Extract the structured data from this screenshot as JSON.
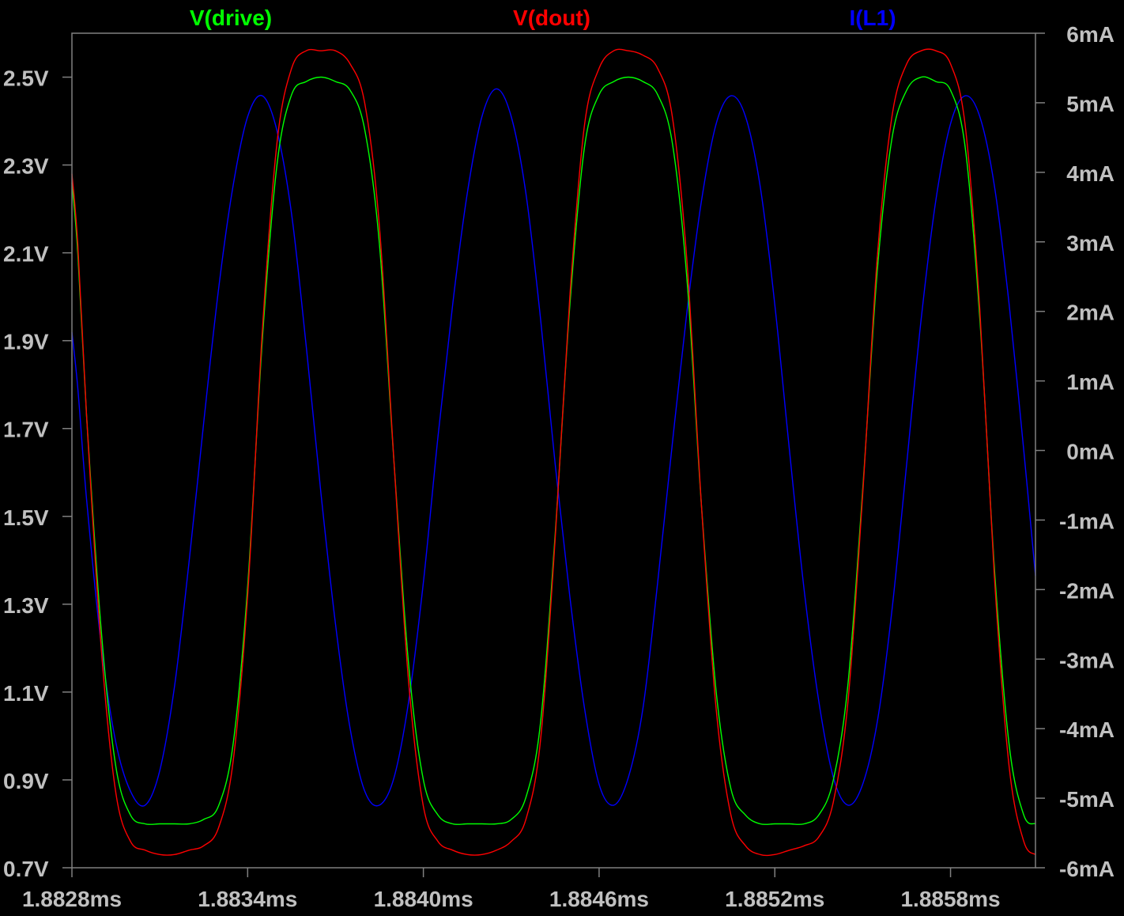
{
  "chart_data": {
    "type": "line",
    "title": "",
    "xlabel": "",
    "ylabel": "",
    "y2label": "",
    "grid": false,
    "background_color": "#000000",
    "axis_color": "#808080",
    "label_color": "#c0c0c0",
    "legend": [
      {
        "name": "V(drive)",
        "color": "#00ff00"
      },
      {
        "name": "V(dout)",
        "color": "#ff0000"
      },
      {
        "name": "I(L1)",
        "color": "#0000ff"
      }
    ],
    "xlim": [
      1.8828,
      1.88609
    ],
    "ylim_left": [
      0.7,
      2.6
    ],
    "ylim_right": [
      -6,
      6
    ],
    "x_ticks": [
      "1.8828ms",
      "1.8834ms",
      "1.8840ms",
      "1.8846ms",
      "1.8852ms",
      "1.8858ms"
    ],
    "x_tick_values": [
      1.8828,
      1.8834,
      1.884,
      1.8846,
      1.8852,
      1.8858
    ],
    "y_left_ticks": [
      "2.5V",
      "2.3V",
      "2.1V",
      "1.9V",
      "1.7V",
      "1.5V",
      "1.3V",
      "1.1V",
      "0.9V",
      "0.7V"
    ],
    "y_left_tick_values": [
      2.5,
      2.3,
      2.1,
      1.9,
      1.7,
      1.5,
      1.3,
      1.1,
      0.9,
      0.7
    ],
    "y_right_ticks": [
      "6mA",
      "5mA",
      "4mA",
      "3mA",
      "2mA",
      "1mA",
      "0mA",
      "-1mA",
      "-2mA",
      "-3mA",
      "-4mA",
      "-5mA",
      "-6mA"
    ],
    "y_right_tick_values": [
      6,
      5,
      4,
      3,
      2,
      1,
      0,
      -1,
      -2,
      -3,
      -4,
      -5,
      -6
    ],
    "series": [
      {
        "name": "V(drive)",
        "axis": "left",
        "color": "#00ff00",
        "x": [
          1.8828,
          1.88282,
          1.88285,
          1.8829,
          1.88295,
          1.883,
          1.88305,
          1.8831,
          1.88315,
          1.8832,
          1.88325,
          1.8833,
          1.88335,
          1.8834,
          1.88345,
          1.8835,
          1.88355,
          1.8836,
          1.88365,
          1.8837,
          1.88375,
          1.8838,
          1.88385,
          1.8839,
          1.88395,
          1.884,
          1.88405,
          1.8841,
          1.88415,
          1.8842,
          1.88425,
          1.8843,
          1.88435,
          1.8844,
          1.88445,
          1.8845,
          1.88455,
          1.8846,
          1.88465,
          1.8847,
          1.88475,
          1.8848,
          1.88485,
          1.8849,
          1.88495,
          1.885,
          1.88505,
          1.8851,
          1.88515,
          1.8852,
          1.88525,
          1.8853,
          1.88535,
          1.8854,
          1.88545,
          1.8855,
          1.88555,
          1.8856,
          1.88565,
          1.8857,
          1.88575,
          1.8858,
          1.88585,
          1.8859,
          1.88595,
          1.886,
          1.88605,
          1.88609
        ],
        "y": [
          2.26,
          2.1,
          1.73,
          1.24,
          0.93,
          0.82,
          0.8,
          0.8,
          0.8,
          0.8,
          0.81,
          0.84,
          0.98,
          1.34,
          1.9,
          2.3,
          2.46,
          2.49,
          2.5,
          2.49,
          2.47,
          2.38,
          2.12,
          1.62,
          1.16,
          0.9,
          0.82,
          0.8,
          0.8,
          0.8,
          0.8,
          0.81,
          0.86,
          1.03,
          1.46,
          1.98,
          2.34,
          2.46,
          2.49,
          2.5,
          2.49,
          2.46,
          2.35,
          2.04,
          1.52,
          1.1,
          0.88,
          0.82,
          0.8,
          0.8,
          0.8,
          0.8,
          0.82,
          0.9,
          1.12,
          1.56,
          2.06,
          2.36,
          2.47,
          2.5,
          2.49,
          2.47,
          2.34,
          1.95,
          1.38,
          0.98,
          0.82,
          0.8
        ]
      },
      {
        "name": "V(dout)",
        "axis": "left",
        "color": "#ff0000",
        "x": [
          1.8828,
          1.88282,
          1.88285,
          1.8829,
          1.88295,
          1.883,
          1.88305,
          1.8831,
          1.88315,
          1.8832,
          1.88325,
          1.8833,
          1.88335,
          1.8834,
          1.88345,
          1.8835,
          1.88355,
          1.8836,
          1.88365,
          1.8837,
          1.88375,
          1.8838,
          1.88385,
          1.8839,
          1.88395,
          1.884,
          1.88405,
          1.8841,
          1.88415,
          1.8842,
          1.88425,
          1.8843,
          1.88435,
          1.8844,
          1.88445,
          1.8845,
          1.88455,
          1.8846,
          1.88465,
          1.8847,
          1.88475,
          1.8848,
          1.88485,
          1.8849,
          1.88495,
          1.885,
          1.88505,
          1.8851,
          1.88515,
          1.8852,
          1.88525,
          1.8853,
          1.88535,
          1.8854,
          1.88545,
          1.8855,
          1.88555,
          1.8856,
          1.88565,
          1.8857,
          1.88575,
          1.8858,
          1.88585,
          1.8859,
          1.88595,
          1.886,
          1.88605,
          1.88609
        ],
        "y": [
          2.28,
          2.12,
          1.73,
          1.2,
          0.87,
          0.76,
          0.74,
          0.73,
          0.73,
          0.74,
          0.75,
          0.79,
          0.94,
          1.32,
          1.92,
          2.35,
          2.52,
          2.56,
          2.56,
          2.56,
          2.53,
          2.44,
          2.16,
          1.62,
          1.12,
          0.84,
          0.76,
          0.74,
          0.73,
          0.73,
          0.74,
          0.76,
          0.81,
          0.99,
          1.45,
          2.0,
          2.39,
          2.52,
          2.56,
          2.56,
          2.55,
          2.52,
          2.41,
          2.08,
          1.52,
          1.06,
          0.82,
          0.75,
          0.73,
          0.73,
          0.74,
          0.75,
          0.77,
          0.85,
          1.08,
          1.55,
          2.09,
          2.41,
          2.53,
          2.56,
          2.56,
          2.53,
          2.39,
          1.97,
          1.36,
          0.93,
          0.76,
          0.73
        ]
      },
      {
        "name": "I(L1)",
        "axis": "right",
        "color": "#0000ff",
        "x": [
          1.8828,
          1.88282,
          1.88285,
          1.8829,
          1.88295,
          1.883,
          1.88305,
          1.8831,
          1.88315,
          1.8832,
          1.88325,
          1.8833,
          1.88335,
          1.8834,
          1.88345,
          1.8835,
          1.88355,
          1.8836,
          1.88365,
          1.8837,
          1.88375,
          1.8838,
          1.88385,
          1.8839,
          1.88395,
          1.884,
          1.88405,
          1.8841,
          1.88415,
          1.8842,
          1.88425,
          1.8843,
          1.88435,
          1.8844,
          1.88445,
          1.8845,
          1.88455,
          1.8846,
          1.88465,
          1.8847,
          1.88475,
          1.8848,
          1.88485,
          1.8849,
          1.88495,
          1.885,
          1.88505,
          1.8851,
          1.88515,
          1.8852,
          1.88525,
          1.8853,
          1.88535,
          1.8854,
          1.88545,
          1.8855,
          1.88555,
          1.8856,
          1.88565,
          1.8857,
          1.88575,
          1.8858,
          1.88585,
          1.8859,
          1.88595,
          1.886,
          1.88605,
          1.88609
        ],
        "y": [
          1.7,
          0.9,
          -0.7,
          -2.8,
          -4.2,
          -4.9,
          -5.1,
          -4.6,
          -3.4,
          -1.6,
          0.4,
          2.3,
          3.8,
          4.8,
          5.1,
          4.6,
          3.4,
          1.5,
          -0.6,
          -2.5,
          -4.0,
          -4.9,
          -5.1,
          -4.7,
          -3.6,
          -1.9,
          0.2,
          2.1,
          3.7,
          4.8,
          5.2,
          4.8,
          3.7,
          1.9,
          -0.2,
          -2.1,
          -3.7,
          -4.8,
          -5.1,
          -4.7,
          -3.7,
          -1.9,
          0.1,
          2.0,
          3.6,
          4.7,
          5.1,
          4.8,
          3.8,
          2.1,
          0.0,
          -2.0,
          -3.6,
          -4.7,
          -5.1,
          -4.8,
          -3.9,
          -2.3,
          -0.2,
          1.9,
          3.6,
          4.7,
          5.1,
          4.8,
          3.8,
          2.1,
          0.0,
          -1.8
        ]
      }
    ]
  }
}
